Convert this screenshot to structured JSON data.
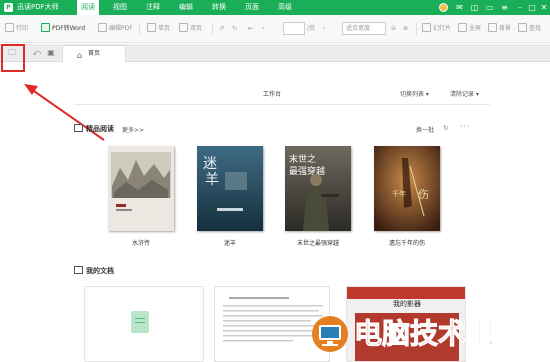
{
  "app": {
    "title": "迅读PDF大师",
    "logo_text": "P"
  },
  "menu": [
    {
      "label": "阅读",
      "active": true
    },
    {
      "label": "视图"
    },
    {
      "label": "注释"
    },
    {
      "label": "编辑"
    },
    {
      "label": "转换"
    },
    {
      "label": "页面"
    },
    {
      "label": "高级"
    }
  ],
  "toolbar": {
    "print": "打印",
    "pdf_to_word": "PDF转Word",
    "edit_pdf": "编辑PDF",
    "single_page": "单页",
    "double_page": "双页",
    "page_separator": "/页",
    "zoom_placeholder": "适合宽度",
    "slideshow": "幻灯片",
    "fullscreen": "全屏",
    "background": "背景",
    "find": "查找"
  },
  "tabs": {
    "home": "首页"
  },
  "workbench": {
    "title": "工作台",
    "switch_list": "切换列表",
    "clear_history": "清除记录"
  },
  "featured": {
    "title": "精品阅读",
    "more": "更多>>",
    "swap": "换一批",
    "books": [
      {
        "title": "水浒传",
        "cover": "shuihu"
      },
      {
        "title": "迷羊",
        "cover": "miyang"
      },
      {
        "title": "末世之最强穿越",
        "cover": "moshi"
      },
      {
        "title": "遗忘千年的伤",
        "cover": "yiwang"
      }
    ]
  },
  "my_docs": {
    "title": "我的文档",
    "movie_card_text": "我的影器"
  },
  "watermark": {
    "text": "电脑技术吧"
  },
  "colors": {
    "brand": "#1aae58",
    "highlight": "#e02a2a"
  }
}
